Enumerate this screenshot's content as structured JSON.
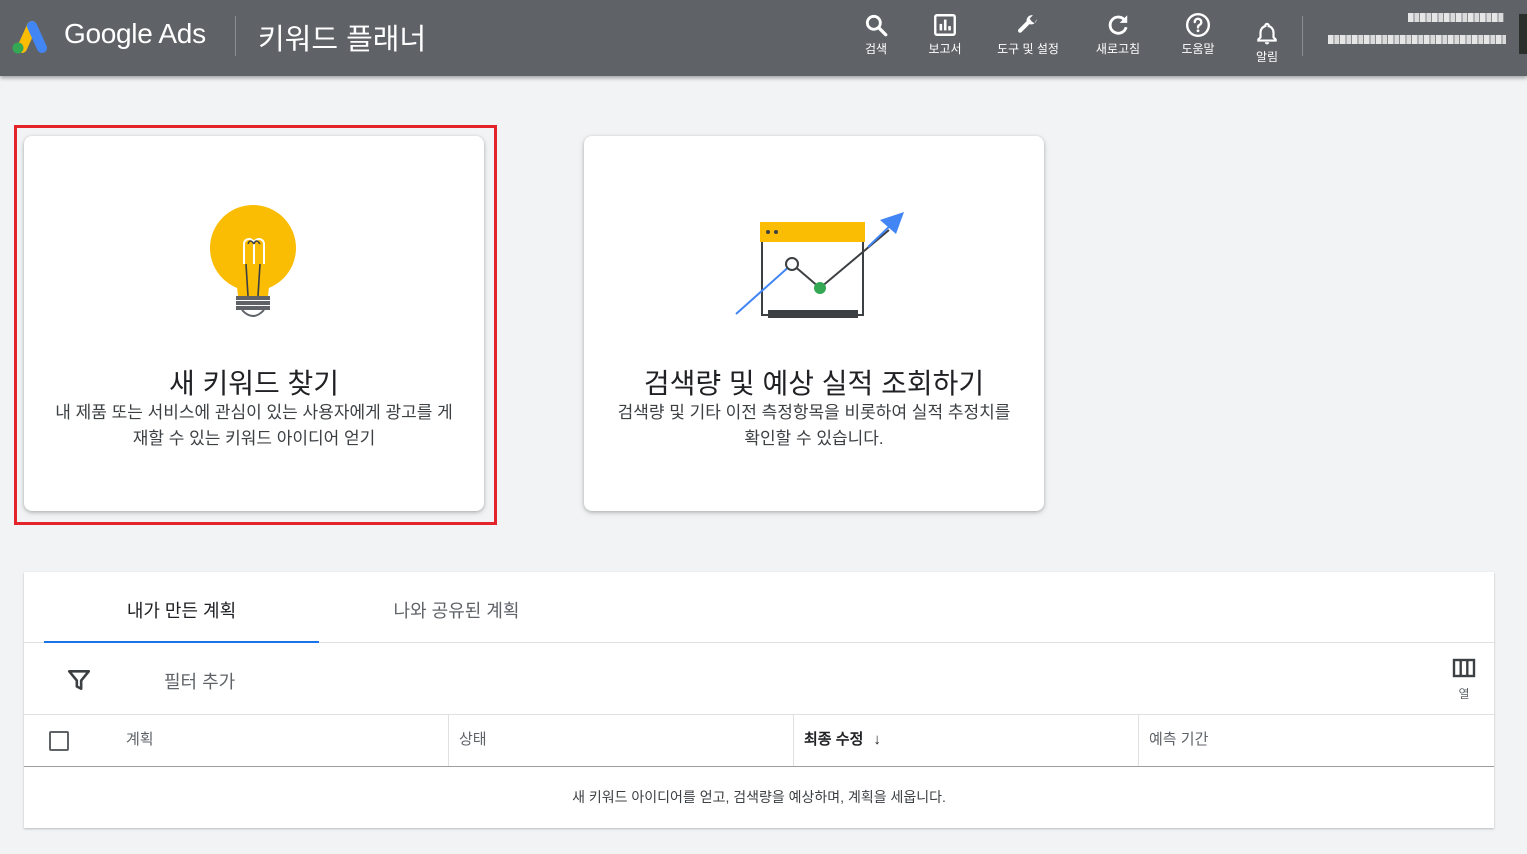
{
  "app": {
    "brand": "Google Ads",
    "page_title": "키워드 플래너"
  },
  "toolbar": {
    "items": [
      {
        "label": "검색",
        "icon": "search-icon"
      },
      {
        "label": "보고서",
        "icon": "reports-icon"
      },
      {
        "label": "도구 및 설정",
        "icon": "wrench-icon"
      },
      {
        "label": "새로고침",
        "icon": "refresh-icon"
      },
      {
        "label": "도움말",
        "icon": "help-icon"
      },
      {
        "label": "알림",
        "icon": "bell-icon"
      }
    ]
  },
  "cards": [
    {
      "title": "새 키워드 찾기",
      "description": "내 제품 또는 서비스에 관심이 있는 사용자에게 광고를 게재할 수 있는 키워드 아이디어 얻기",
      "icon": "lightbulb-icon"
    },
    {
      "title": "검색량 및 예상 실적 조회하기",
      "description": "검색량 및 기타 이전 측정항목을 비롯하여 실적 추정치를 확인할 수 있습니다.",
      "icon": "trend-chart-icon"
    }
  ],
  "plans": {
    "tabs": [
      {
        "label": "내가 만든 계획",
        "active": true
      },
      {
        "label": "나와 공유된 계획",
        "active": false
      }
    ],
    "filter_label": "필터 추가",
    "columns_label": "열",
    "columns": [
      "계획",
      "상태",
      "최종 수정",
      "예측 기간"
    ],
    "sort_column": "최종 수정",
    "empty_message": "새 키워드 아이디어를 얻고, 검색량을 예상하며, 계획을 세웁니다."
  },
  "colors": {
    "topbar": "#5f6368",
    "highlight": "#e3242b",
    "accent": "#1a73e8",
    "bulb": "#fbbc04",
    "chart_point": "#34a853"
  }
}
